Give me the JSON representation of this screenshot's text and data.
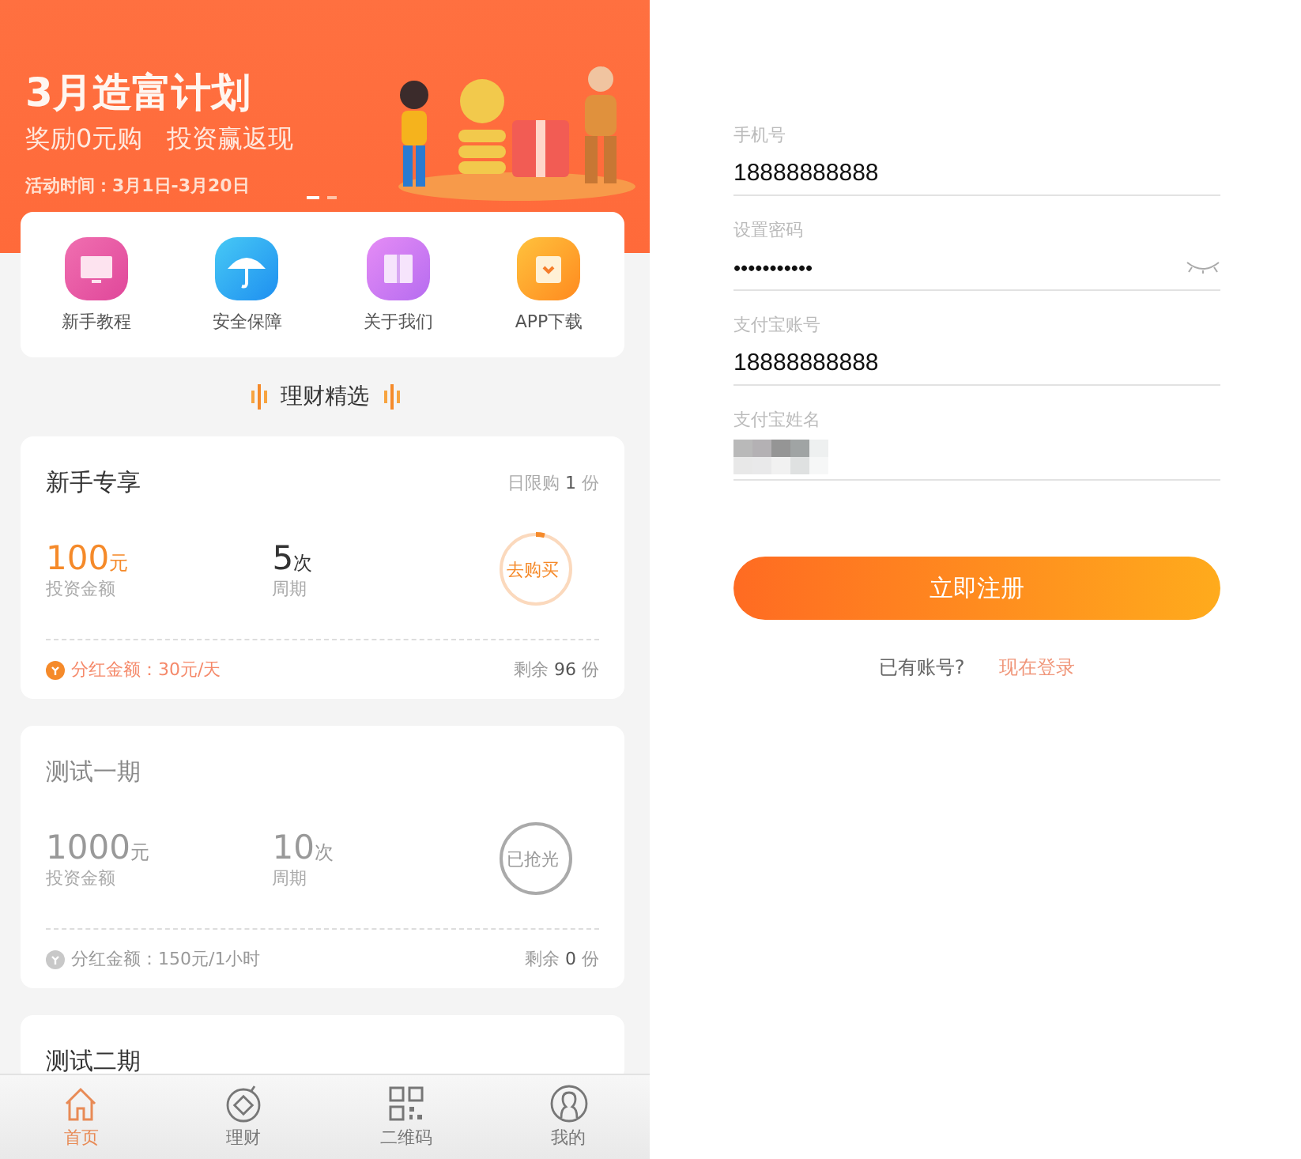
{
  "banner": {
    "title": "3月造富计划",
    "subtitle": "奖励0元购   投资赢返现",
    "period": "活动时间：3月1日-3月20日",
    "slides": [
      {
        "selected": true
      },
      {
        "selected": false
      }
    ]
  },
  "shortcuts": [
    {
      "kind": "tutorial",
      "label": "新手教程"
    },
    {
      "kind": "security",
      "label": "安全保障"
    },
    {
      "kind": "about",
      "label": "关于我们"
    },
    {
      "kind": "download",
      "label": "APP下载"
    }
  ],
  "section_title": "理财精选",
  "products": [
    {
      "name": "新手专享",
      "limit_label": "日限购",
      "limit_value": "1",
      "limit_unit": "份",
      "amount": "100",
      "amount_unit": "元",
      "amount_label": "投资金额",
      "period": "5",
      "period_unit": "次",
      "period_label": "周期",
      "action": "去购买",
      "sold_out": false,
      "level": 0.04,
      "dividend": "分红金额：30元/天",
      "remaining_label": "剩余",
      "remaining_value": "96",
      "remaining_unit": "份"
    },
    {
      "name": "测试一期",
      "amount": "1000",
      "amount_unit": "元",
      "amount_label": "投资金额",
      "period": "10",
      "period_unit": "次",
      "period_label": "周期",
      "action": "已抢光",
      "sold_out": true,
      "dividend": "分红金额：150元/1小时",
      "remaining_label": "剩余",
      "remaining_value": "0",
      "remaining_unit": "份"
    },
    {
      "name": "测试二期",
      "sold_out": false
    }
  ],
  "tab_bar": [
    {
      "kind": "home",
      "label": "首页",
      "selected": true
    },
    {
      "kind": "finance",
      "label": "理财",
      "selected": false
    },
    {
      "kind": "qrcode",
      "label": "二维码",
      "selected": false
    },
    {
      "kind": "profile",
      "label": "我的",
      "selected": false
    }
  ],
  "form": {
    "fields": [
      {
        "kind": "text",
        "label": "手机号",
        "value": "18888888888"
      },
      {
        "kind": "password",
        "label": "设置密码",
        "value": "•••••••••••"
      },
      {
        "kind": "text",
        "label": "支付宝账号",
        "value": "18888888888"
      },
      {
        "kind": "redacted",
        "label": "支付宝姓名"
      }
    ],
    "submit": "立即注册",
    "login_prompt": "已有账号?",
    "login_link": "现在登录"
  }
}
